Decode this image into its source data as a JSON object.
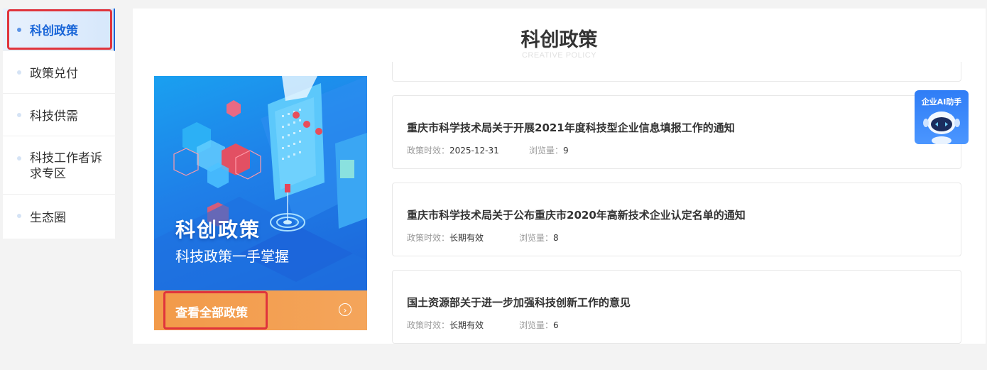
{
  "sidebar": {
    "items": [
      {
        "label": "科创政策",
        "active": true
      },
      {
        "label": "政策兑付"
      },
      {
        "label": "科技供需"
      },
      {
        "label": "科技工作者诉求专区"
      },
      {
        "label": "生态圈"
      }
    ]
  },
  "main": {
    "title": "科创政策",
    "subtitle": "CREATIVE POLICY"
  },
  "banner": {
    "title": "科创政策",
    "subtitle": "科技政策一手掌握",
    "view_all": "查看全部政策",
    "arrow_icon": "chevron-right-circle-icon"
  },
  "policies": [
    {
      "title": "重庆市科学技术局关于开展2021年度科技型企业信息填报工作的通知",
      "validity_label": "政策时效：",
      "validity": "2025-12-31",
      "views_label": "浏览量：",
      "views": "9"
    },
    {
      "title": "重庆市科学技术局关于公布重庆市2020年高新技术企业认定名单的通知",
      "validity_label": "政策时效：",
      "validity": "长期有效",
      "views_label": "浏览量：",
      "views": "8"
    },
    {
      "title": "国土资源部关于进一步加强科技创新工作的意见",
      "validity_label": "政策时效：",
      "validity": "长期有效",
      "views_label": "浏览量：",
      "views": "6"
    }
  ],
  "ai_assistant": {
    "label": "企业AI助手",
    "icon": "robot-icon"
  },
  "colors": {
    "accent": "#1a66d8",
    "highlight": "#e0343c",
    "banner_footer": "#f29a49"
  }
}
